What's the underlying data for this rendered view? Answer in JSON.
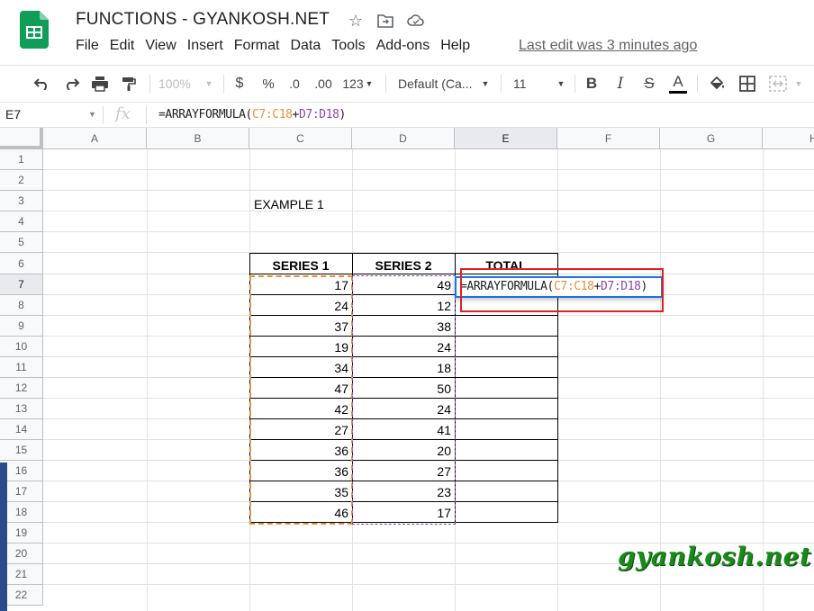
{
  "app": {
    "doc_title": "FUNCTIONS - GYANKOSH.NET",
    "last_edit": "Last edit was 3 minutes ago",
    "menu": [
      "File",
      "Edit",
      "View",
      "Insert",
      "Format",
      "Data",
      "Tools",
      "Add-ons",
      "Help"
    ]
  },
  "toolbar": {
    "zoom": "100%",
    "currency": "$",
    "percent": "%",
    "dec_decrease": ".0",
    "dec_increase": ".00",
    "more_formats": "123",
    "font": "Default (Ca...",
    "font_size": "11",
    "bold": "B",
    "italic": "I",
    "strike": "S",
    "text_color": "A"
  },
  "formula_bar": {
    "cell_ref": "E7",
    "fx": "fx",
    "formula_prefix": "=ARRAYFORMULA(",
    "range1": "C7:C18",
    "plus": "+",
    "range2": "D7:D18",
    "formula_suffix": ")"
  },
  "grid": {
    "columns": [
      "A",
      "B",
      "C",
      "D",
      "E",
      "F",
      "G",
      "H"
    ],
    "rows": [
      "1",
      "2",
      "3",
      "4",
      "5",
      "6",
      "7",
      "8",
      "9",
      "10",
      "11",
      "12",
      "13",
      "14",
      "15",
      "16",
      "17",
      "18",
      "19",
      "20",
      "21",
      "22"
    ],
    "example_label": "EXAMPLE 1",
    "headers": {
      "series1": "SERIES 1",
      "series2": "SERIES 2",
      "total": "TOTAL"
    },
    "series1": [
      "17",
      "24",
      "37",
      "19",
      "34",
      "47",
      "42",
      "27",
      "36",
      "36",
      "35",
      "46"
    ],
    "series2": [
      "49",
      "12",
      "38",
      "24",
      "18",
      "50",
      "24",
      "41",
      "20",
      "27",
      "23",
      "17"
    ]
  },
  "watermark": "gyankosh.net",
  "colors": {
    "range1": "#e69138",
    "range2": "#8e44ad",
    "selection": "#1a73e8",
    "highlight": "#e02020",
    "watermark": "#1a8a1a",
    "sheets_green": "#0f9d58"
  }
}
